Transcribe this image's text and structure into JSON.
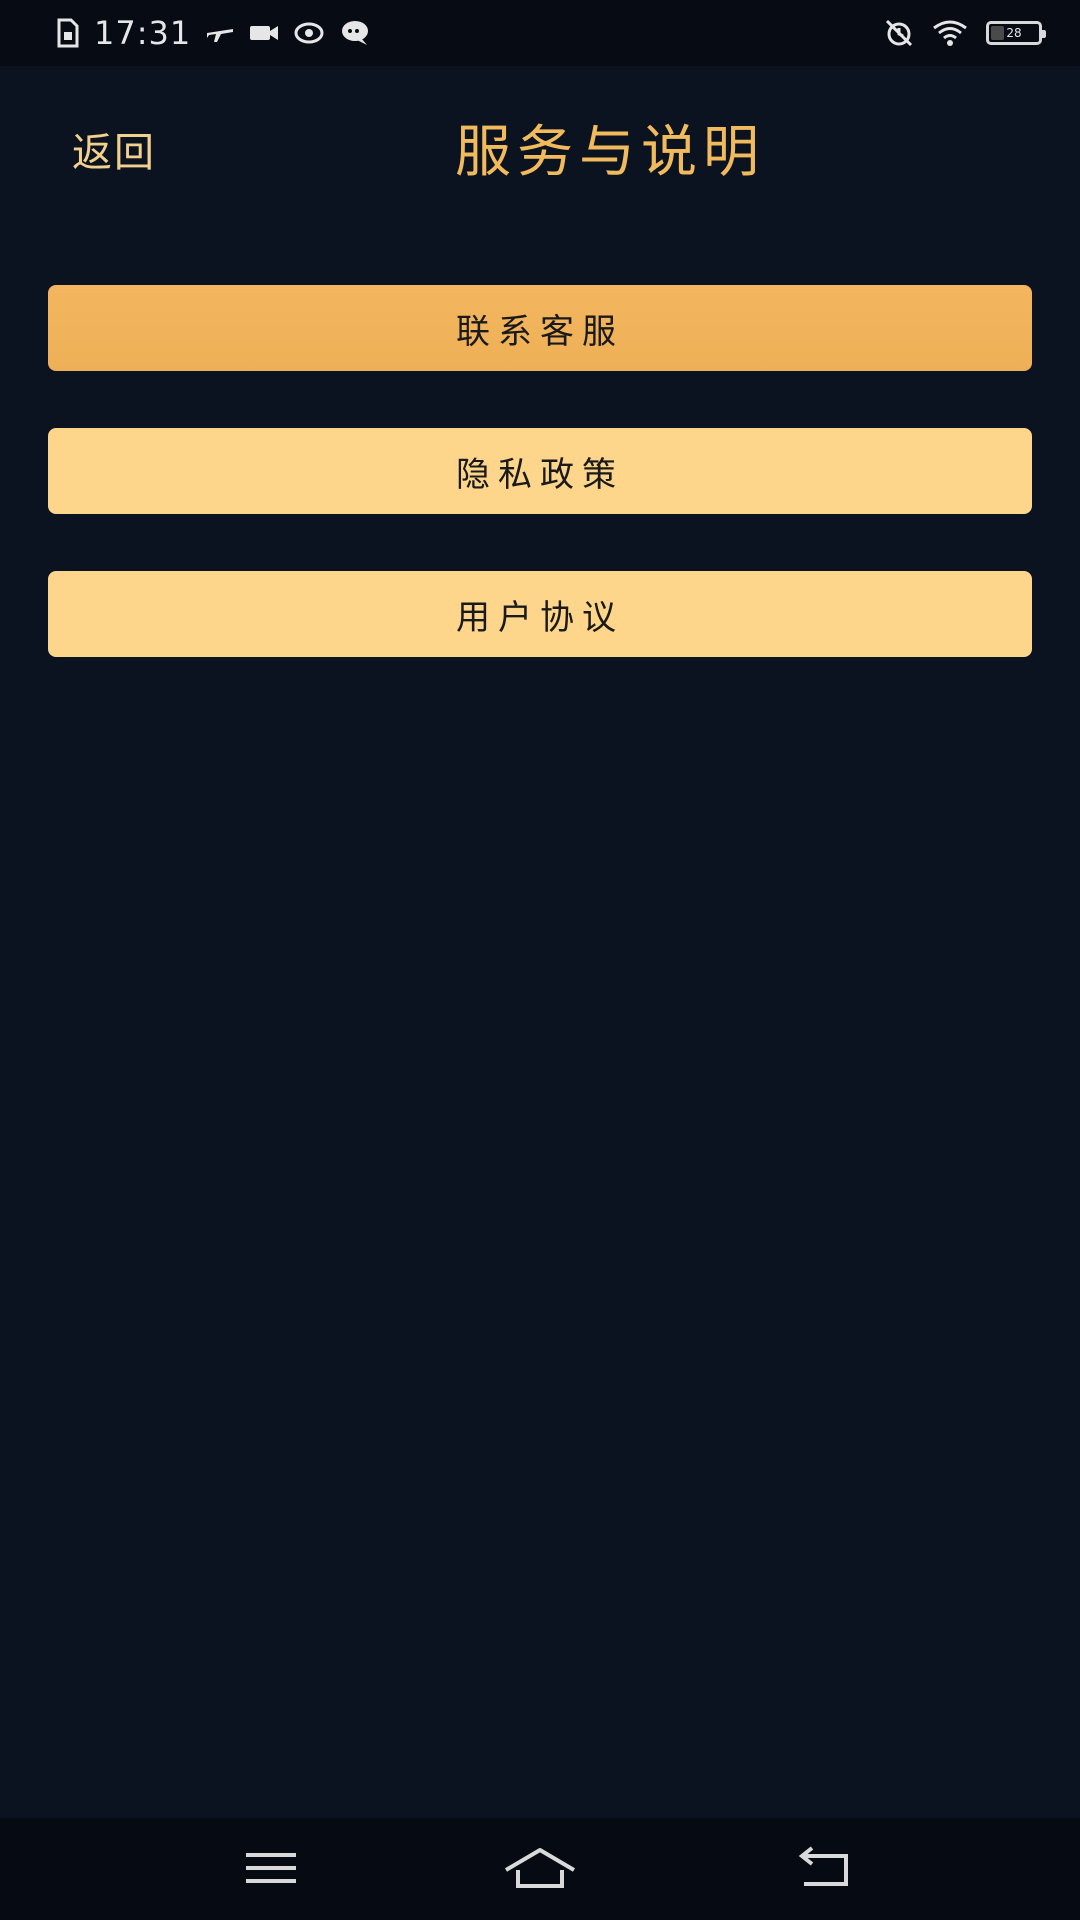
{
  "status_bar": {
    "time": "17:31",
    "battery_label": "28",
    "battery_level": 0.28,
    "icons": [
      "sim-card-icon",
      "airplane-icon",
      "video-call-icon",
      "eye-icon",
      "chat-bubble-icon",
      "alarm-off-icon",
      "wifi-icon",
      "battery-icon"
    ]
  },
  "header": {
    "back_label": "返回",
    "title": "服务与说明"
  },
  "menu": {
    "items": [
      {
        "label": "联系客服",
        "state": "active"
      },
      {
        "label": "隐私政策",
        "state": "normal"
      },
      {
        "label": "用户协议",
        "state": "normal"
      }
    ]
  },
  "nav_bar": {
    "icons": [
      "menu-icon",
      "home-icon",
      "back-icon"
    ]
  },
  "colors": {
    "background": "#0b1220",
    "title": "#f1bb5d",
    "back_link": "#f2d18f",
    "button_active": "#f0b35a",
    "button_normal": "#fdd68b"
  }
}
